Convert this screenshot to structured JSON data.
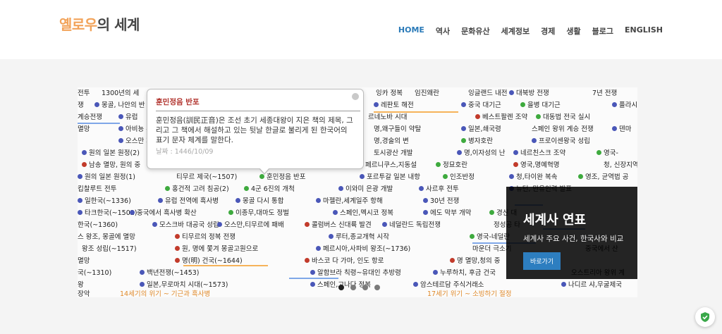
{
  "header": {
    "logo_accent": "옐로우",
    "logo_rest": "의 세계",
    "nav": [
      {
        "label": "HOME",
        "active": true
      },
      {
        "label": "역사",
        "active": false
      },
      {
        "label": "문화유산",
        "active": false
      },
      {
        "label": "세계정보",
        "active": false
      },
      {
        "label": "경제",
        "active": false
      },
      {
        "label": "생활",
        "active": false
      },
      {
        "label": "블로그",
        "active": false
      },
      {
        "label": "ENGLISH",
        "active": false
      }
    ]
  },
  "slider": {
    "tooltip": {
      "title": "훈민정음 반포",
      "body": "훈민정음(訓民正音)은 조선 초기 세종대왕이 지은 책의 제목, 그리고 그 책에서 해설하고 있는 뒷날 한글로 불리게 된 한국어의 표기 문자 체계를 말한다.",
      "date": "날짜 : 1446/10/09"
    },
    "caption": {
      "title": "세계사 연표",
      "subtitle": "세계사 주요 사건, 한국사와 비교",
      "button": "바로가기"
    },
    "active_slide": 1,
    "slide_count": 4,
    "timeline_items": [
      {
        "text": "전투",
        "color": "none"
      },
      {
        "text": "1300년의 세",
        "color": "none"
      },
      {
        "text": "쟁",
        "color": "none"
      },
      {
        "text": "몽골, 나안의 반",
        "color": "blue"
      },
      {
        "text": "계승전쟁",
        "color": "none"
      },
      {
        "text": "유럽",
        "color": "blue"
      },
      {
        "text": "멸망",
        "color": "none"
      },
      {
        "text": "아비뇽 유",
        "color": "blue"
      },
      {
        "text": "오스만 제국",
        "color": "blue"
      },
      {
        "text": "원의 일본 원정(2)",
        "color": "blue"
      },
      {
        "text": "남송 멸망, 원의 중",
        "color": "red"
      },
      {
        "text": "원의 일본 원정(1)",
        "color": "blue"
      },
      {
        "text": "킵찰루트 전투",
        "color": "none"
      },
      {
        "text": "일한국(~1336)",
        "color": "blue"
      },
      {
        "text": "타크한국(~1502)",
        "color": "blue"
      },
      {
        "text": "한국(~1360)",
        "color": "none"
      },
      {
        "text": "스 왕조, 몽골에 멸망",
        "color": "none"
      },
      {
        "text": "왕조 성립(~1517)",
        "color": "none"
      },
      {
        "text": "멸망",
        "color": "none"
      },
      {
        "text": "국(~1310)",
        "color": "none"
      },
      {
        "text": "왕",
        "color": "none"
      },
      {
        "text": "장악",
        "color": "none"
      },
      {
        "text": "티무르 제국(~1507)",
        "color": "none"
      },
      {
        "text": "훈민정음 반포",
        "color": "green"
      },
      {
        "text": "홍건적 고려 침공(2)",
        "color": "green"
      },
      {
        "text": "4군 6진의 개척",
        "color": "green"
      },
      {
        "text": "유럽 전역에 흑사병",
        "color": "blue"
      },
      {
        "text": "몽골 다시 통합",
        "color": "blue"
      },
      {
        "text": "중국에서 흑사병 확산",
        "color": "blue"
      },
      {
        "text": "이종무,대마도 정벌",
        "color": "green"
      },
      {
        "text": "모스크바 대공국 성립",
        "color": "blue"
      },
      {
        "text": "오스만,티무르에 패배",
        "color": "blue"
      },
      {
        "text": "티무르의 정복 전쟁",
        "color": "red"
      },
      {
        "text": "원, 명에 쫓겨 몽골고원으로",
        "color": "red"
      },
      {
        "text": "명(明) 건국(~1644)",
        "color": "red"
      },
      {
        "text": "백년전쟁(~1453)",
        "color": "blue"
      },
      {
        "text": "일본,무로마치 시대(~1573)",
        "color": "blue"
      },
      {
        "text": "14세기의 위기 ~ 기근과 흑사병",
        "color": "orange-text"
      },
      {
        "text": "잉카 정복",
        "color": "none"
      },
      {
        "text": "임진왜란",
        "color": "none"
      },
      {
        "text": "레판토 해전",
        "color": "blue"
      },
      {
        "text": "르네노바 시대",
        "color": "none"
      },
      {
        "text": "명,왜구들이 약탈",
        "color": "none"
      },
      {
        "text": "명,경술의 변",
        "color": "none"
      },
      {
        "text": "토시광산 개발",
        "color": "none"
      },
      {
        "text": "페르니쿠스,지동설",
        "color": "none"
      },
      {
        "text": "포르투갈 일본 내항",
        "color": "blue"
      },
      {
        "text": "이와미 은광 개발",
        "color": "blue"
      },
      {
        "text": "마젤란,세계일주 항해",
        "color": "blue"
      },
      {
        "text": "스페인,멕시코 정복",
        "color": "blue"
      },
      {
        "text": "콜럼버스 신대륙 발견",
        "color": "red"
      },
      {
        "text": "네덜란드 독립전쟁",
        "color": "blue"
      },
      {
        "text": "루터,종교개혁 시작",
        "color": "blue"
      },
      {
        "text": "페르시아,사파비 왕조(~1736)",
        "color": "blue"
      },
      {
        "text": "바스코 다 가마, 인도 항로",
        "color": "red"
      },
      {
        "text": "알함브라 칙령~유대인 추방령",
        "color": "blue"
      },
      {
        "text": "스페인,고나다 정복",
        "color": "blue"
      },
      {
        "text": "잉글랜드 내전",
        "color": "none"
      },
      {
        "text": "대북방 전쟁",
        "color": "blue"
      },
      {
        "text": "7년 전쟁",
        "color": "none"
      },
      {
        "text": "중국 대기근",
        "color": "blue"
      },
      {
        "text": "을병 대기근",
        "color": "green"
      },
      {
        "text": "플라시 전투",
        "color": "blue"
      },
      {
        "text": "베스트팔렌 조약",
        "color": "red"
      },
      {
        "text": "대동법 전국 실시",
        "color": "green"
      },
      {
        "text": "일본,쇄국령",
        "color": "blue"
      },
      {
        "text": "스페인 왕위 계승 전쟁",
        "color": "none"
      },
      {
        "text": "덴마",
        "color": "blue"
      },
      {
        "text": "병자호란",
        "color": "green"
      },
      {
        "text": "프로이센왕국 성립",
        "color": "blue"
      },
      {
        "text": "명,이자성의 난",
        "color": "blue"
      },
      {
        "text": "네르친스크 조약",
        "color": "blue"
      },
      {
        "text": "영국-",
        "color": "green"
      },
      {
        "text": "정묘호란",
        "color": "green"
      },
      {
        "text": "영국,명예혁명",
        "color": "red"
      },
      {
        "text": "청, 신장지역",
        "color": "none"
      },
      {
        "text": "인조반정",
        "color": "green"
      },
      {
        "text": "청,타이완 복속",
        "color": "blue"
      },
      {
        "text": "영조, 균역법 공",
        "color": "green"
      },
      {
        "text": "사르후 전투",
        "color": "blue"
      },
      {
        "text": "뉴턴, 만유인력 발표",
        "color": "blue"
      },
      {
        "text": "30년 전쟁",
        "color": "blue"
      },
      {
        "text": "에도 막부 개막",
        "color": "blue"
      },
      {
        "text": "경신 대",
        "color": "green"
      },
      {
        "text": "정성공 타",
        "color": "none"
      },
      {
        "text": "영국-네덜란",
        "color": "green"
      },
      {
        "text": "마운더 극소기",
        "color": "none"
      },
      {
        "text": "명 멸망,청의 중",
        "color": "red"
      },
      {
        "text": "누루하치, 후금 건국",
        "color": "blue"
      },
      {
        "text": "암스테르담 주식거래소",
        "color": "blue"
      },
      {
        "text": "오스트리아 왕위 계",
        "color": "none"
      },
      {
        "text": "나디르 샤,무굴제국",
        "color": "blue"
      },
      {
        "text": "중국에서 산",
        "color": "none"
      },
      {
        "text": "17세기 위기 ~ 소빙하기 절정",
        "color": "orange-text"
      }
    ]
  }
}
